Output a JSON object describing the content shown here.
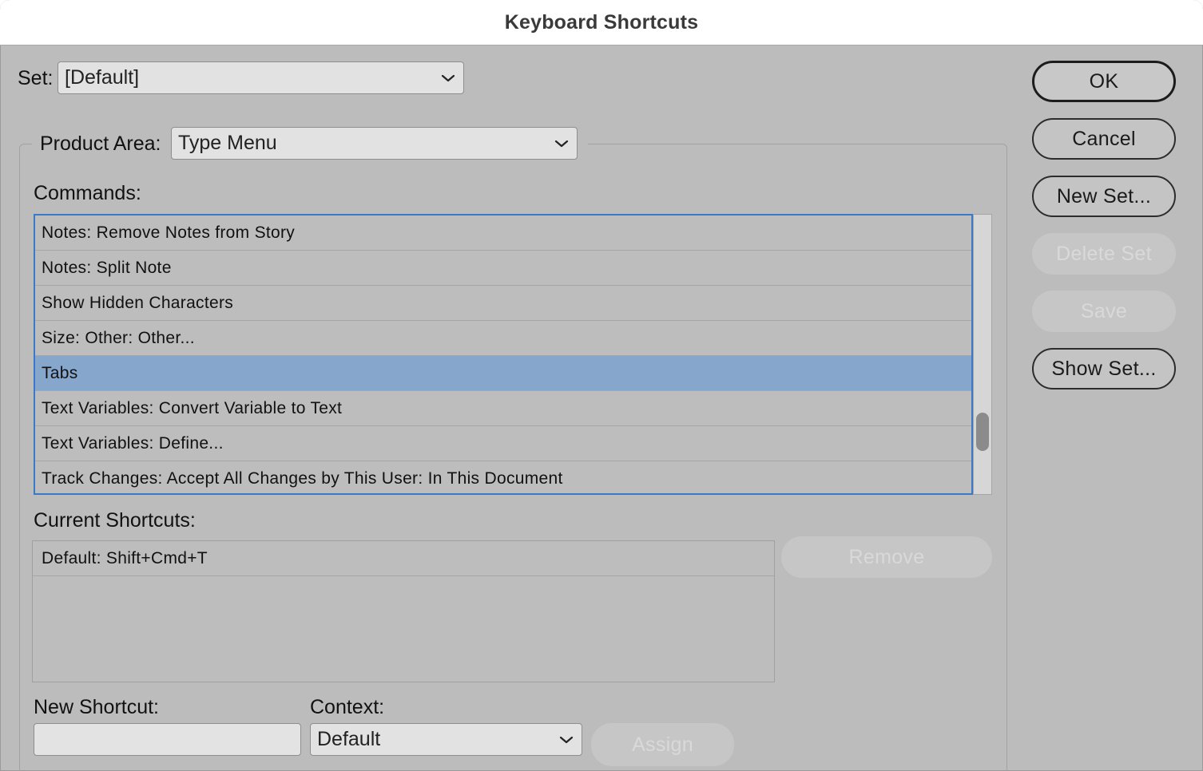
{
  "window": {
    "title": "Keyboard Shortcuts"
  },
  "set": {
    "label": "Set:",
    "value": "[Default]"
  },
  "product_area": {
    "label": "Product Area:",
    "value": "Type Menu"
  },
  "commands": {
    "label": "Commands:",
    "items": [
      "Notes: Remove Notes from Story",
      "Notes: Split Note",
      "Show Hidden Characters",
      "Size: Other: Other...",
      "Tabs",
      "Text Variables: Convert Variable to Text",
      "Text Variables: Define...",
      "Track Changes: Accept All Changes by This User: In This Document"
    ],
    "selected_index": 4
  },
  "current_shortcuts": {
    "label": "Current Shortcuts:",
    "items": [
      "Default: Shift+Cmd+T"
    ],
    "remove_label": "Remove"
  },
  "new_shortcut": {
    "label": "New Shortcut:",
    "value": ""
  },
  "context": {
    "label": "Context:",
    "value": "Default"
  },
  "assign_label": "Assign",
  "side_buttons": {
    "ok": "OK",
    "cancel": "Cancel",
    "new_set": "New Set...",
    "delete_set": "Delete Set",
    "save": "Save",
    "show_set": "Show Set..."
  },
  "colors": {
    "dialog_bg": "#bcbcbc",
    "selection": "#87a6cb",
    "focus_ring": "#3a78c9"
  },
  "icons": {
    "dropdown": "chevron-down-icon"
  }
}
